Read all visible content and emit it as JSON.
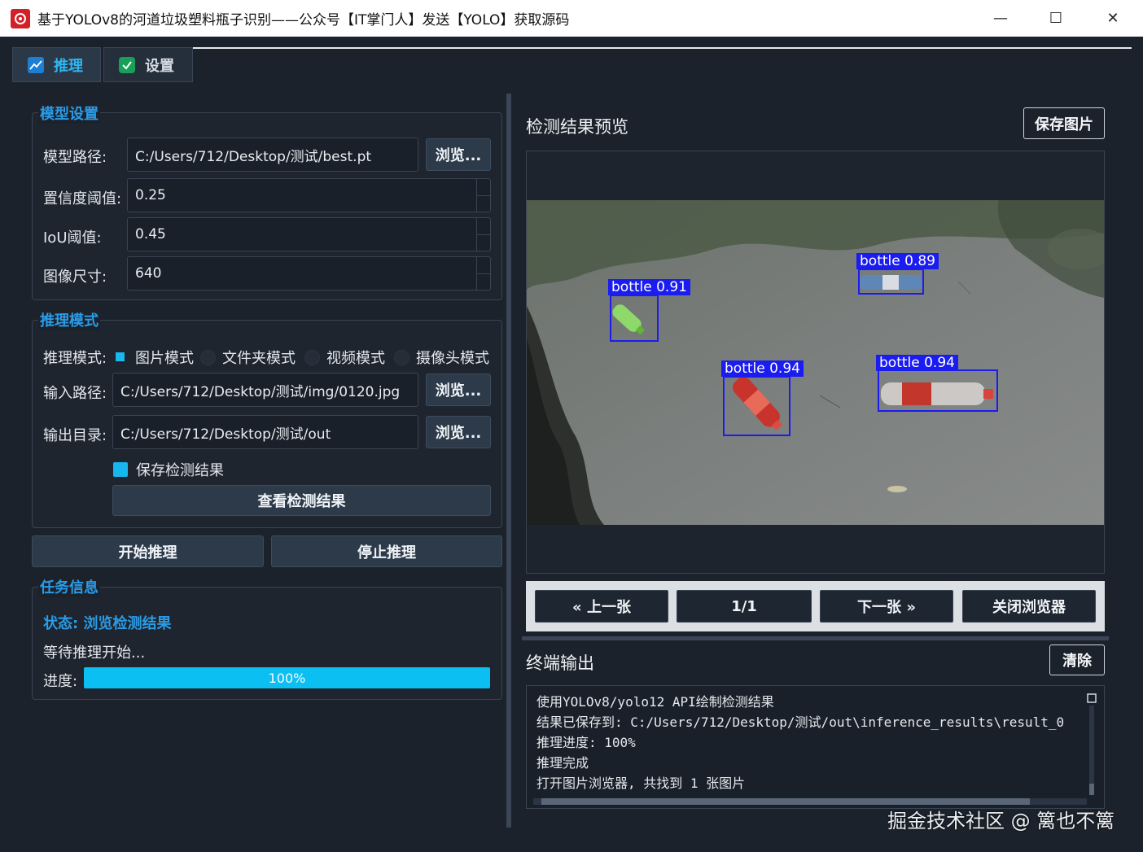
{
  "window": {
    "title": "基于YOLOv8的河道垃圾塑料瓶子识别——公众号【IT掌门人】发送【YOLO】获取源码",
    "minimize": "—",
    "maximize": "☐",
    "close": "✕"
  },
  "tabs": [
    {
      "label": "推理",
      "icon": "chart-icon",
      "active": true
    },
    {
      "label": "设置",
      "icon": "check-icon",
      "active": false
    }
  ],
  "model_settings": {
    "title": "模型设置",
    "model_path_label": "模型路径:",
    "model_path": "C:/Users/712/Desktop/测试/best.pt",
    "browse": "浏览...",
    "conf_label": "置信度阈值:",
    "conf": "0.25",
    "iou_label": "IoU阈值:",
    "iou": "0.45",
    "imgsz_label": "图像尺寸:",
    "imgsz": "640"
  },
  "inference_mode": {
    "title": "推理模式",
    "mode_label": "推理模式:",
    "modes": [
      "图片模式",
      "文件夹模式",
      "视频模式",
      "摄像头模式"
    ],
    "selected": "图片模式",
    "input_label": "输入路径:",
    "input_path": "C:/Users/712/Desktop/测试/img/0120.jpg",
    "output_label": "输出目录:",
    "output_dir": "C:/Users/712/Desktop/测试/out",
    "browse": "浏览...",
    "save_checkbox": "保存检测结果",
    "save_checked": true,
    "view_results": "查看检测结果"
  },
  "actions": {
    "start": "开始推理",
    "stop": "停止推理"
  },
  "task_info": {
    "title": "任务信息",
    "status": "状态: 浏览检测结果",
    "message": "等待推理开始...",
    "progress_label": "进度:",
    "progress_text": "100%",
    "progress_value": 100
  },
  "preview": {
    "title": "检测结果预览",
    "save_image": "保存图片",
    "detections": [
      {
        "label": "bottle  0.91"
      },
      {
        "label": "bottle  0.89"
      },
      {
        "label": "bottle  0.94"
      },
      {
        "label": "bottle  0.94"
      }
    ]
  },
  "navigation": {
    "prev": "« 上一张",
    "counter": "1/1",
    "next": "下一张 »",
    "close_browser": "关闭浏览器"
  },
  "terminal": {
    "title": "终端输出",
    "clear": "清除",
    "lines": [
      "使用YOLOv8/yolo12 API绘制检测结果",
      "结果已保存到: C:/Users/712/Desktop/测试/out\\inference_results\\result_0",
      "推理进度: 100%",
      "推理完成",
      "打开图片浏览器, 共找到 1 张图片"
    ]
  },
  "watermark": "掘金技术社区 @ 篱也不篱",
  "colors": {
    "accent": "#19b8f0",
    "group_title": "#2b9be6",
    "detection_box": "#1a1cf0",
    "background": "#1c222b"
  }
}
